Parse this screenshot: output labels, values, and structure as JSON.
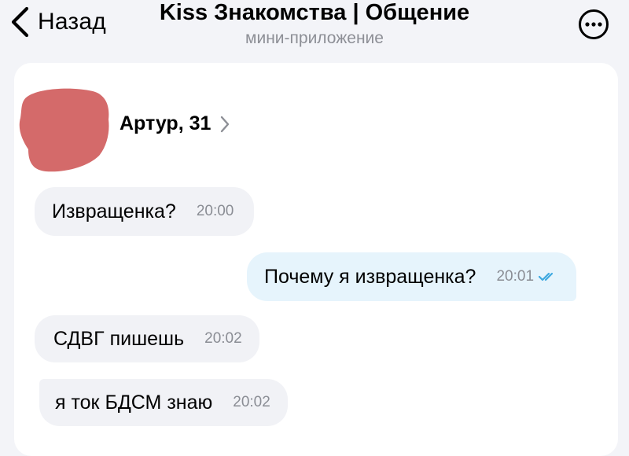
{
  "header": {
    "back_label": "Назад",
    "title": "Kiss Знакомства | Общение",
    "subtitle": "мини-приложение"
  },
  "chat": {
    "peer_name": "Артур, 31",
    "messages": [
      {
        "direction": "in",
        "text": "Извращенка?",
        "time": "20:00"
      },
      {
        "direction": "out",
        "text": "Почему я извращенка?",
        "time": "20:01",
        "status": "read"
      },
      {
        "direction": "in",
        "text": "СДВГ пишешь",
        "time": "20:02"
      },
      {
        "direction": "in",
        "text": "я ток БДСМ знаю",
        "time": "20:02"
      }
    ]
  },
  "colors": {
    "page_background": "#f3f4f8",
    "card_background": "#ffffff",
    "incoming_bubble": "#f1f2f6",
    "outgoing_bubble": "#e6f4fc",
    "read_ticks": "#3fa9e0",
    "avatar_redaction": "#d46a6a"
  },
  "icons": [
    "back-chevron-icon",
    "more-options-icon",
    "chevron-right-icon",
    "double-check-icon"
  ]
}
